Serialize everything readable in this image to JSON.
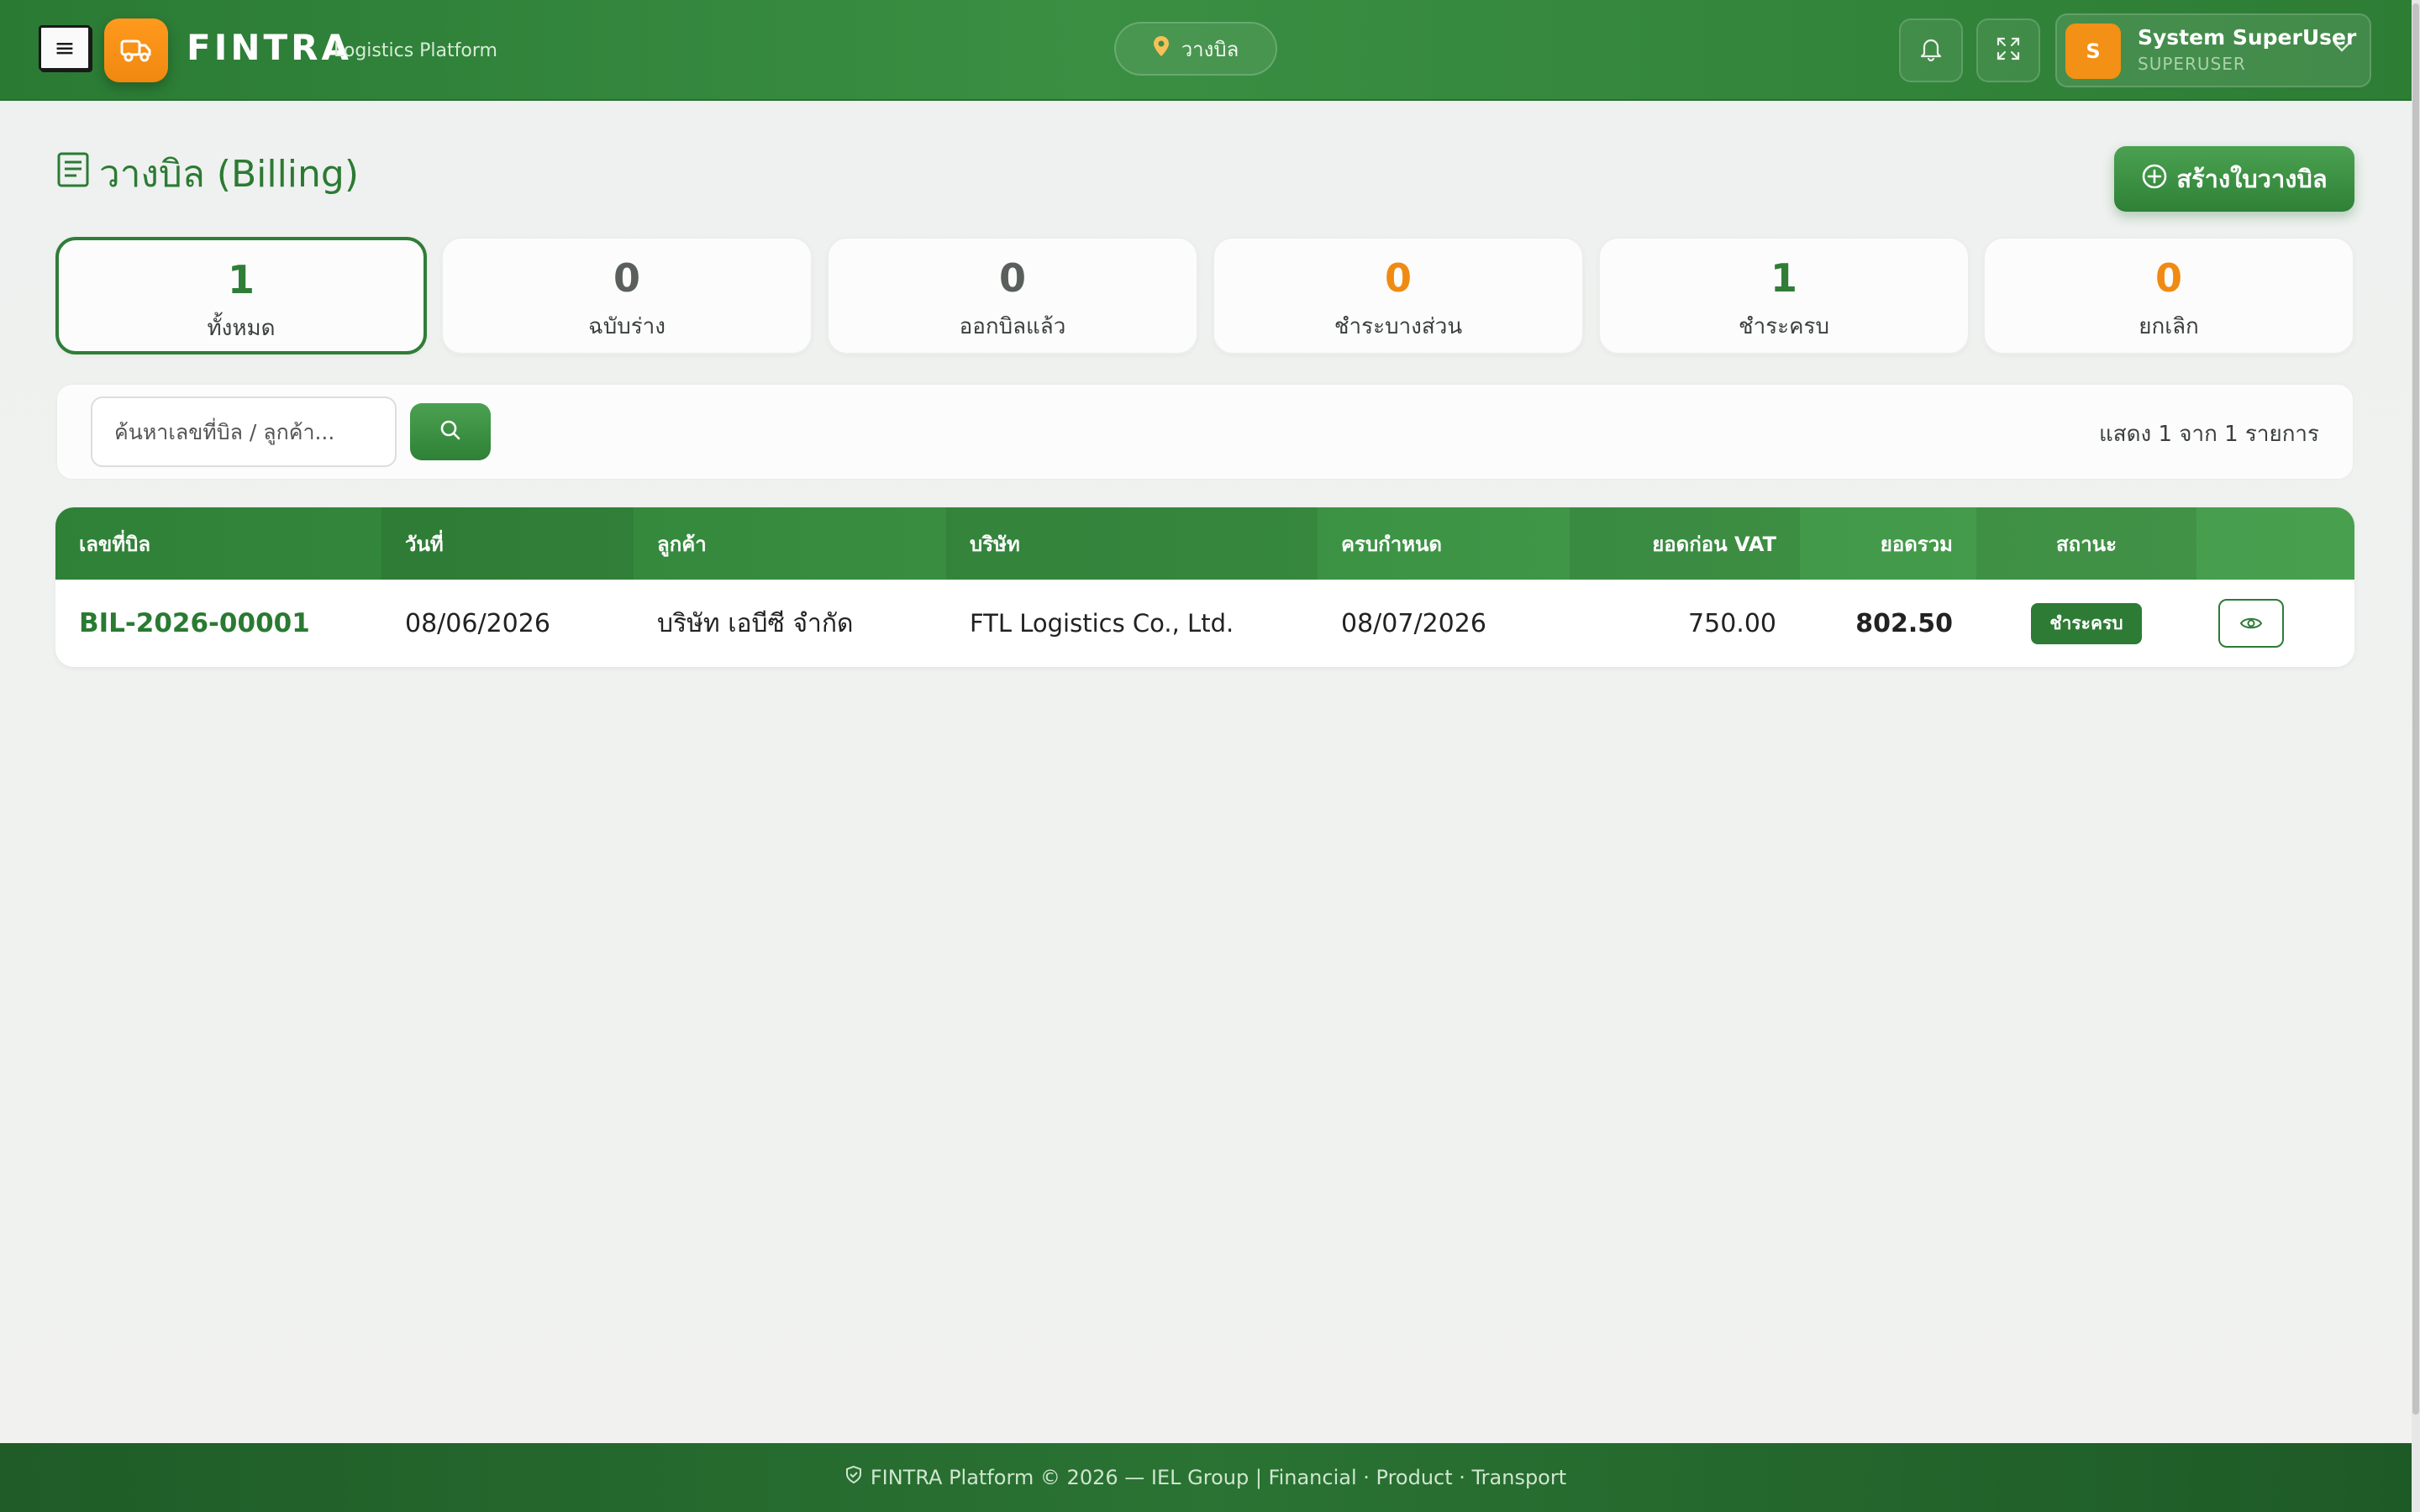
{
  "header": {
    "brand": "FINTRA",
    "brand_sub": "Logistics Platform",
    "location": "วางบิล",
    "user_initial": "S",
    "user_name": "System SuperUser",
    "user_role": "SUPERUSER"
  },
  "page": {
    "title": "วางบิล (Billing)",
    "create_button": "สร้างใบวางบิล"
  },
  "stats": [
    {
      "value": "1",
      "label": "ทั้งหมด",
      "color": "#2f7d37"
    },
    {
      "value": "0",
      "label": "ฉบับร่าง",
      "color": "#5a5f5c"
    },
    {
      "value": "0",
      "label": "ออกบิลแล้ว",
      "color": "#5a5f5c"
    },
    {
      "value": "0",
      "label": "ชำระบางส่วน",
      "color": "#f08a12"
    },
    {
      "value": "1",
      "label": "ชำระครบ",
      "color": "#2f7d37"
    },
    {
      "value": "0",
      "label": "ยกเลิก",
      "color": "#f08a12"
    }
  ],
  "search": {
    "placeholder": "ค้นหาเลขที่บิล / ลูกค้า...",
    "result_count": "แสดง 1 จาก 1 รายการ"
  },
  "table": {
    "columns": [
      "เลขที่บิล",
      "วันที่",
      "ลูกค้า",
      "บริษัท",
      "ครบกำหนด",
      "ยอดก่อน VAT",
      "ยอดรวม",
      "สถานะ"
    ],
    "rows": [
      {
        "bill_no": "BIL-2026-00001",
        "date": "08/06/2026",
        "customer": "บริษัท เอบีซี จำกัด",
        "company": "FTL Logistics Co., Ltd.",
        "due": "08/07/2026",
        "subtotal": "750.00",
        "total": "802.50",
        "status": "ชำระครบ"
      }
    ]
  },
  "footer": {
    "text": "FINTRA Platform © 2026 — IEL Group | Financial · Product · Transport"
  },
  "colors": {
    "primary": "#2f7d37",
    "accent": "#f39016"
  }
}
